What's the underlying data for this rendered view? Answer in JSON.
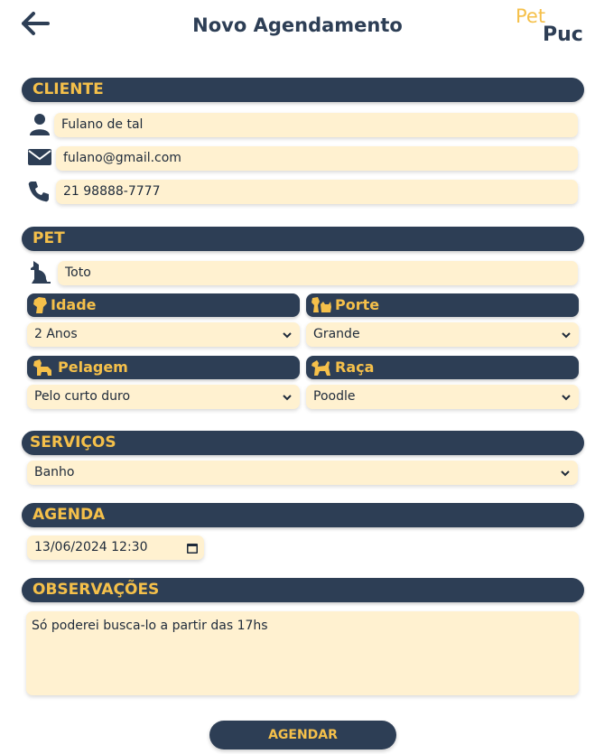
{
  "header": {
    "title": "Novo Agendamento",
    "back_icon": "arrow-left-icon",
    "logo": {
      "pet": "Pet",
      "puc": "Puc"
    }
  },
  "colors": {
    "navy": "#2d3e55",
    "gold": "#f5c04a",
    "field_bg": "#fff1d0"
  },
  "cliente": {
    "label": "CLIENTE",
    "name": "Fulano de tal",
    "email": "fulano@gmail.com",
    "phone": "21 98888-7777"
  },
  "pet": {
    "label": "PET",
    "name": "Toto",
    "idade": {
      "label": "Idade",
      "value": "2 Anos"
    },
    "porte": {
      "label": "Porte",
      "value": "Grande"
    },
    "pelagem": {
      "label": "Pelagem",
      "value": "Pelo curto duro"
    },
    "raca": {
      "label": "Raça",
      "value": "Poodle"
    }
  },
  "servicos": {
    "label": "SERVIÇOS",
    "value": "Banho"
  },
  "agenda": {
    "label": "AGENDA",
    "value": "13/06/2024 12:30"
  },
  "observacoes": {
    "label": "OBSERVAÇÕES",
    "value": "Só poderei busca-lo a partir das 17hs"
  },
  "submit_label": "AGENDAR"
}
